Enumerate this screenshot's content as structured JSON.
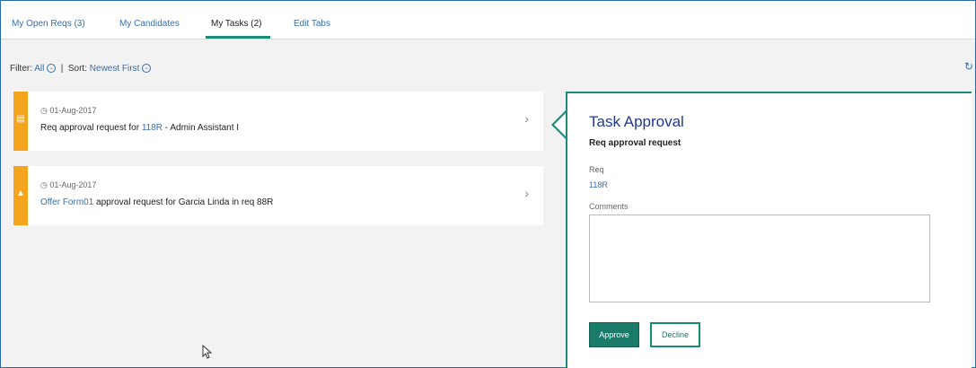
{
  "tabs": [
    {
      "label": "My Open Reqs (3)",
      "active": false
    },
    {
      "label": "My Candidates",
      "active": false
    },
    {
      "label": "My Tasks (2)",
      "active": true
    },
    {
      "label": "Edit Tabs",
      "active": false
    }
  ],
  "filterbar": {
    "filter_label": "Filter:",
    "filter_value": "All",
    "separator": "|",
    "sort_label": "Sort:",
    "sort_value": "Newest First"
  },
  "tasks": [
    {
      "icon": "approval-icon",
      "date": "01-Aug-2017",
      "prefix": "Req approval request for ",
      "link": "118R",
      "suffix": " - Admin Assistant I"
    },
    {
      "icon": "warning-icon",
      "date": "01-Aug-2017",
      "prefix": "",
      "link": "Offer Form01",
      "suffix": " approval request for Garcia Linda in req 88R"
    }
  ],
  "panel": {
    "title": "Task Approval",
    "subtitle": "Req approval request",
    "req_label": "Req",
    "req_value": "118R",
    "comments_label": "Comments",
    "comments_value": "",
    "approve_label": "Approve",
    "decline_label": "Decline"
  },
  "colors": {
    "accent": "#1a8a7a",
    "warning_bar": "#f5a51d",
    "link": "#3a6ea5",
    "title": "#1f3a93"
  }
}
